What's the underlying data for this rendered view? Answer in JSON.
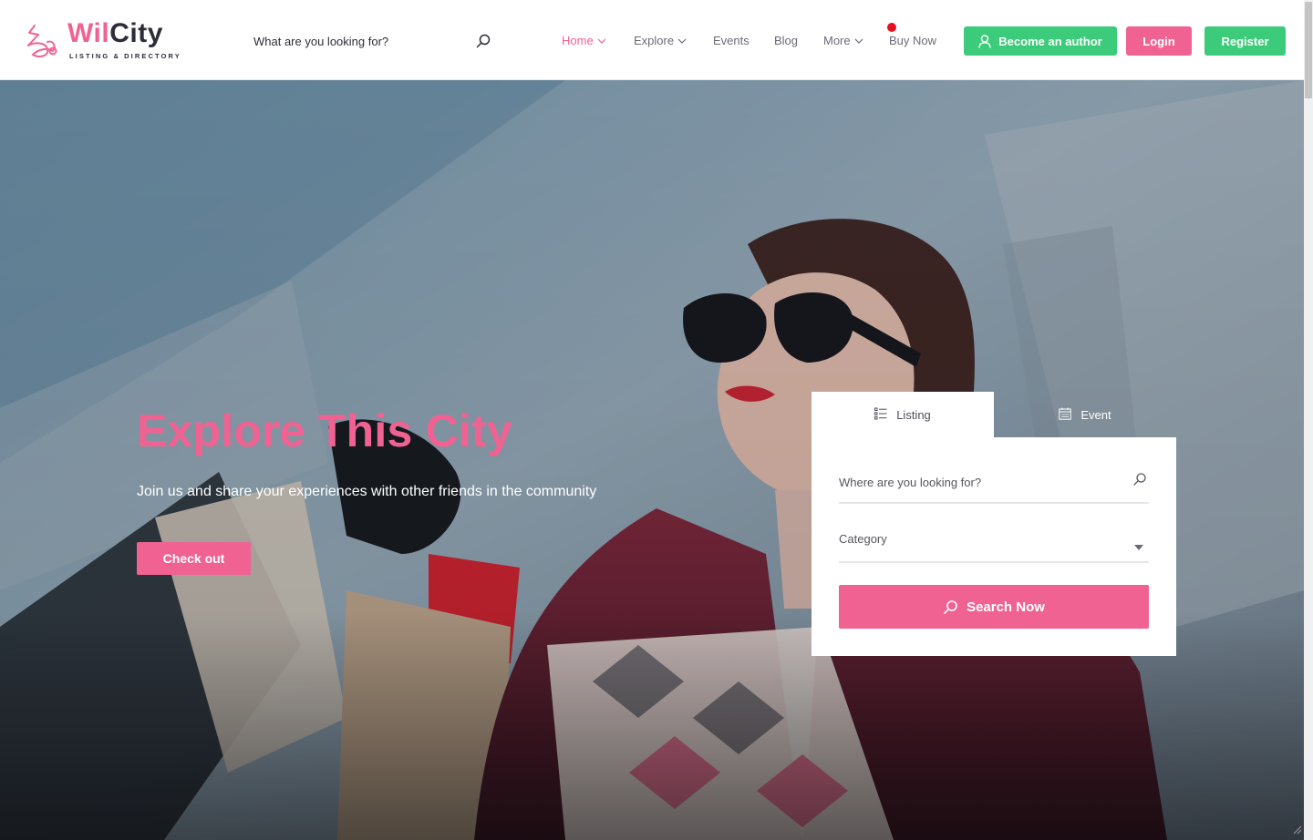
{
  "brand": {
    "name_part1": "Wil",
    "name_part2": "City",
    "tagline": "LISTING & DIRECTORY",
    "accent": "#f06292",
    "green": "#3ccb7a",
    "dark": "#2d2d3a"
  },
  "header": {
    "search_placeholder": "What are you looking for?",
    "search_icon": "search-icon",
    "nav": [
      {
        "label": "Home",
        "active": true,
        "dropdown": true
      },
      {
        "label": "Explore",
        "active": false,
        "dropdown": true
      },
      {
        "label": "Events",
        "active": false,
        "dropdown": false
      },
      {
        "label": "Blog",
        "active": false,
        "dropdown": false
      },
      {
        "label": "More",
        "active": false,
        "dropdown": true
      },
      {
        "label": "Buy Now",
        "active": false,
        "dropdown": false,
        "badge_dot": true
      }
    ],
    "become_author_label": "Become an author",
    "login_label": "Login",
    "register_label": "Register"
  },
  "hero": {
    "title": "Explore This City",
    "subtitle": "Join us and share your experiences with other friends in the community",
    "cta_label": "Check out"
  },
  "search_panel": {
    "tabs": [
      {
        "label": "Listing",
        "icon": "list-icon",
        "active": true
      },
      {
        "label": "Event",
        "icon": "calendar-icon",
        "active": false
      }
    ],
    "where_placeholder": "Where are you looking for?",
    "category_label": "Category",
    "submit_label": "Search Now"
  }
}
